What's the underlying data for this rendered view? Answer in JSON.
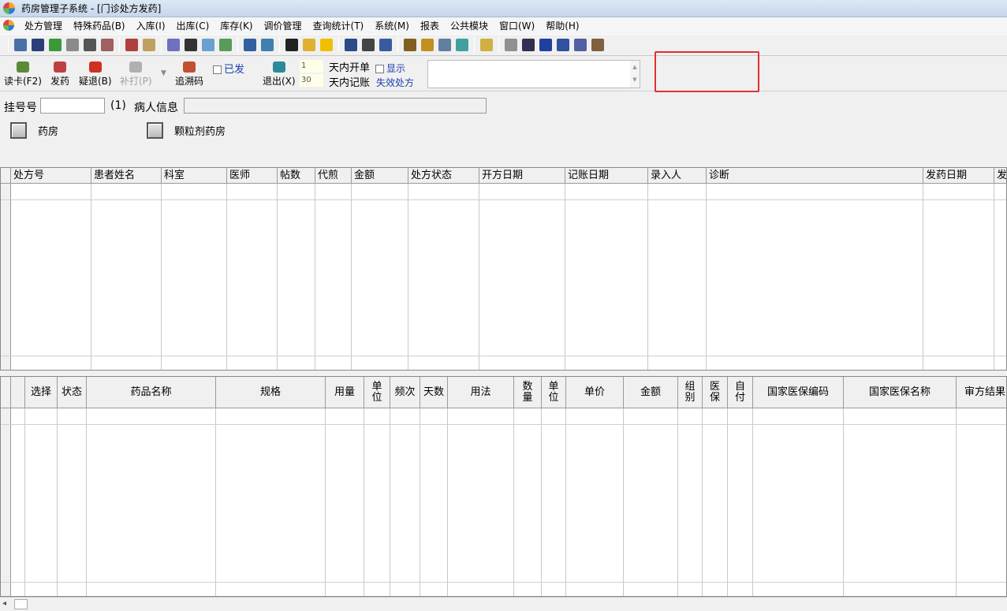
{
  "window": {
    "title": "药房管理子系统 - [门诊处方发药]"
  },
  "menu": [
    "处方管理",
    "特殊药品(B)",
    "入库(I)",
    "出库(C)",
    "库存(K)",
    "调价管理",
    "查询统计(T)",
    "系统(M)",
    "报表",
    "公共模块",
    "窗口(W)",
    "帮助(H)"
  ],
  "actions": {
    "read_card": "读卡(F2)",
    "dispense": "发药",
    "question_return": "疑退(B)",
    "reprint": "补打(P)",
    "trace_code": "追溯码",
    "dispensed_label": "已发",
    "exit": "退出(X)",
    "days_open_value": "1",
    "days_open_label": "天内开单",
    "show_label": "显示",
    "days_billing_value": "30",
    "days_billing_label": "天内记账",
    "invalid_rx": "失效处方"
  },
  "patient": {
    "reg_label": "挂号号",
    "count": "(1)",
    "info_label": "病人信息"
  },
  "pharmacies": [
    "药房",
    "颗粒剂药房"
  ],
  "rx_table": {
    "headers": [
      "处方号",
      "患者姓名",
      "科室",
      "医师",
      "帖数",
      "代煎",
      "金额",
      "处方状态",
      "开方日期",
      "记账日期",
      "录入人",
      "诊断",
      "发药日期",
      "发"
    ]
  },
  "drug_table": {
    "headers": [
      "选择",
      "状态",
      "药品名称",
      "规格",
      "用量",
      "单位",
      "频次",
      "天数",
      "用法",
      "数量",
      "单位",
      "单价",
      "金额",
      "组别",
      "医保",
      "自付",
      "国家医保编码",
      "国家医保名称",
      "审方结果"
    ]
  },
  "colors": {
    "highlight": "#e03030",
    "link": "#1a3fb0"
  }
}
